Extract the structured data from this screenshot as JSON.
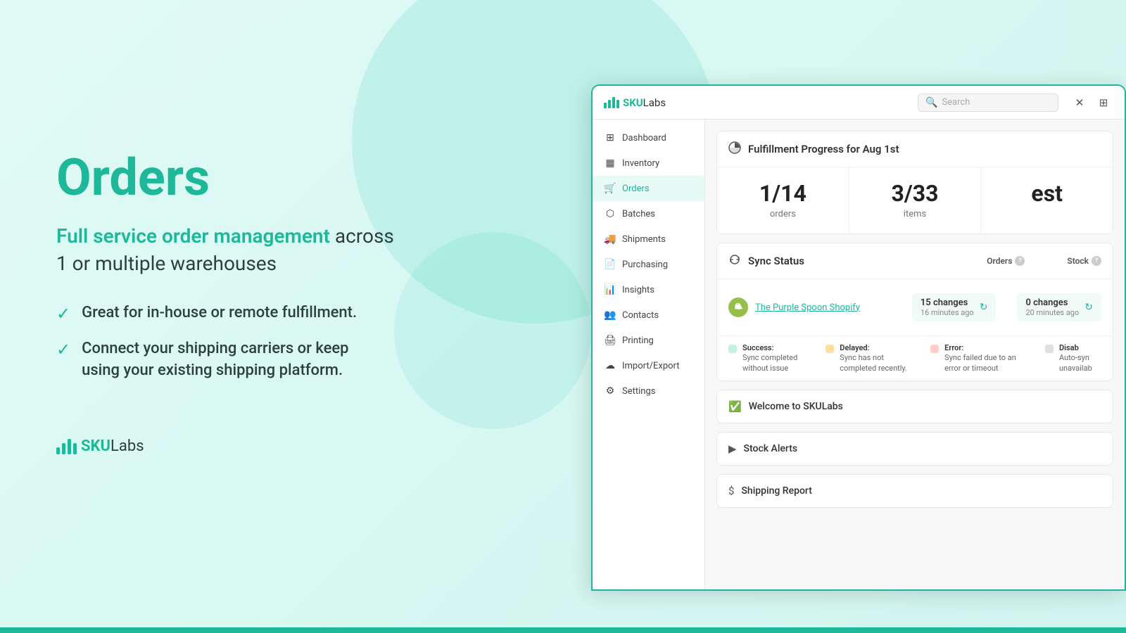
{
  "background": {
    "color": "#e0faf5"
  },
  "left_panel": {
    "title": "Orders",
    "subtitle_highlight": "Full service order management",
    "subtitle_rest": " across\n1 or multiple warehouses",
    "features": [
      "Great for in-house or remote fulfillment.",
      "Connect your shipping carriers or keep\nusing your existing shipping platform."
    ],
    "logo": {
      "sku": "SKU",
      "labs": "Labs"
    }
  },
  "browser": {
    "topbar": {
      "logo_sku": "SKU",
      "logo_labs": "Labs",
      "search_placeholder": "Search"
    },
    "sidebar": {
      "items": [
        {
          "id": "dashboard",
          "label": "Dashboard",
          "icon": "grid"
        },
        {
          "id": "inventory",
          "label": "Inventory",
          "icon": "box"
        },
        {
          "id": "orders",
          "label": "Orders",
          "icon": "shopping-cart",
          "active": true
        },
        {
          "id": "batches",
          "label": "Batches",
          "icon": "layers"
        },
        {
          "id": "shipments",
          "label": "Shipments",
          "icon": "truck"
        },
        {
          "id": "purchasing",
          "label": "Purchasing",
          "icon": "file-text"
        },
        {
          "id": "insights",
          "label": "Insights",
          "icon": "bar-chart"
        },
        {
          "id": "contacts",
          "label": "Contacts",
          "icon": "users"
        },
        {
          "id": "printing",
          "label": "Printing",
          "icon": "printer"
        },
        {
          "id": "import-export",
          "label": "Import/Export",
          "icon": "upload"
        },
        {
          "id": "settings",
          "label": "Settings",
          "icon": "settings"
        }
      ]
    },
    "main": {
      "fulfillment": {
        "title": "Fulfillment Progress for Aug 1st",
        "stats": [
          {
            "number": "1/14",
            "label": "orders"
          },
          {
            "number": "3/33",
            "label": "items"
          },
          {
            "number": "est",
            "label": ""
          }
        ]
      },
      "sync_status": {
        "title": "Sync Status",
        "col_orders": "Orders",
        "col_stock": "Stock",
        "store_name": "The Purple Spoon Shopify",
        "orders_changes": "15 changes",
        "orders_time": "16 minutes ago",
        "stock_changes": "0 changes",
        "stock_time": "20 minutes ago",
        "legend": [
          {
            "type": "success",
            "label": "Success:",
            "desc": "Sync completed without issue"
          },
          {
            "type": "delayed",
            "label": "Delayed:",
            "desc": "Sync has not completed recently."
          },
          {
            "type": "error",
            "label": "Error:",
            "desc": "Sync failed due to an error or timeout"
          },
          {
            "type": "disabled",
            "label": "Disab",
            "desc": "Auto-syn unavailab"
          }
        ]
      },
      "welcome": {
        "title": "Welcome to SKULabs"
      },
      "stock_alerts": {
        "title": "Stock Alerts"
      },
      "shipping_report": {
        "title": "Shipping Report"
      }
    }
  }
}
